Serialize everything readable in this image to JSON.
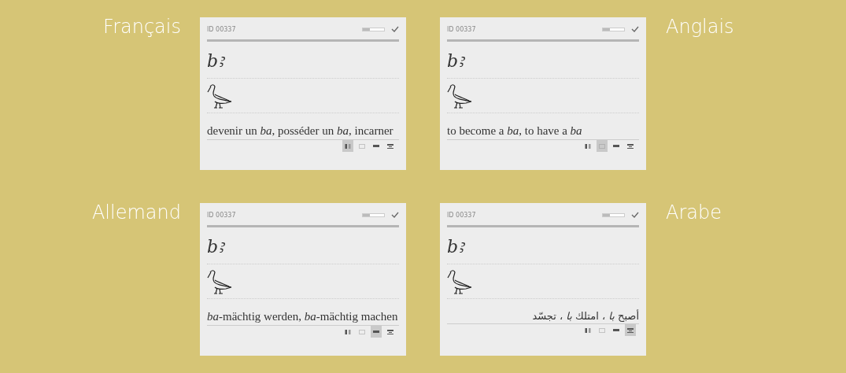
{
  "cards": [
    {
      "language": "Français",
      "id": "ID 00337",
      "progress": {
        "level": 0.33
      },
      "transliteration": "bꜣ",
      "translation": "devenir un *ba*, posséder un *ba*, incarner",
      "rtl": false,
      "views": [
        {
          "kind": "columns",
          "selected": true
        },
        {
          "kind": "grid",
          "selected": false
        },
        {
          "kind": "bar",
          "selected": false
        },
        {
          "kind": "split",
          "selected": false
        }
      ]
    },
    {
      "language": "Anglais",
      "id": "ID 00337",
      "progress": {
        "level": 0.33
      },
      "transliteration": "bꜣ",
      "translation": "to become a *ba*, to have a *ba*",
      "rtl": false,
      "views": [
        {
          "kind": "columns",
          "selected": false
        },
        {
          "kind": "grid",
          "selected": true
        },
        {
          "kind": "bar",
          "selected": false
        },
        {
          "kind": "split",
          "selected": false
        }
      ]
    },
    {
      "language": "Allemand",
      "id": "ID 00337",
      "progress": {
        "level": 0.33
      },
      "transliteration": "bꜣ",
      "translation": "*ba*-mächtig werden, *ba*-mächtig machen",
      "rtl": false,
      "views": [
        {
          "kind": "columns",
          "selected": false
        },
        {
          "kind": "grid",
          "selected": false
        },
        {
          "kind": "bar",
          "selected": true
        },
        {
          "kind": "split",
          "selected": false
        }
      ]
    },
    {
      "language": "Arabe",
      "id": "ID 00337",
      "progress": {
        "level": 0.33
      },
      "transliteration": "bꜣ",
      "translation": "أصبح *با* ، امتلك *با* ، تجسّد",
      "rtl": true,
      "views": [
        {
          "kind": "columns",
          "selected": false
        },
        {
          "kind": "grid",
          "selected": false
        },
        {
          "kind": "bar",
          "selected": false
        },
        {
          "kind": "split",
          "selected": true
        }
      ]
    }
  ]
}
